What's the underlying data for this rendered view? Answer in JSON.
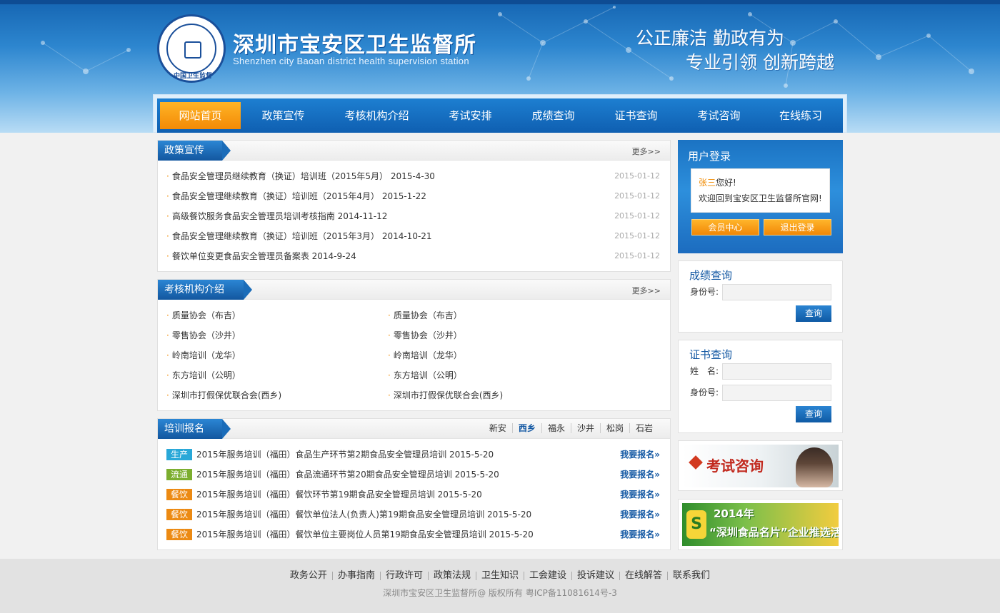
{
  "header": {
    "site_title": "深圳市宝安区卫生监督所",
    "site_subtitle": "Shenzhen city Baoan district  health supervision station",
    "slogan_line1": "公正廉洁  勤政有为",
    "slogan_line2": "专业引领  创新跨越",
    "logo_text": "中国卫生监督"
  },
  "nav": {
    "items": [
      "网站首页",
      "政策宣传",
      "考核机构介绍",
      "考试安排",
      "成绩查询",
      "证书查询",
      "考试咨询",
      "在线练习"
    ],
    "active_index": 0
  },
  "policy": {
    "title": "政策宣传",
    "more": "更多>>",
    "items": [
      {
        "text": "食品安全管理员继续教育（换证）培训班（2015年5月） 2015-4-30",
        "date": "2015-01-12"
      },
      {
        "text": "食品安全管理继续教育（换证）培训班（2015年4月） 2015-1-22",
        "date": "2015-01-12"
      },
      {
        "text": "高级餐饮服务食品安全管理员培训考核指南 2014-11-12",
        "date": "2015-01-12"
      },
      {
        "text": "食品安全管理继续教育（换证）培训班（2015年3月） 2014-10-21",
        "date": "2015-01-12"
      },
      {
        "text": "餐饮单位变更食品安全管理员备案表 2014-9-24",
        "date": "2015-01-12"
      }
    ]
  },
  "orgs": {
    "title": "考核机构介绍",
    "more": "更多>>",
    "left": [
      "质量协会（布吉）",
      "零售协会（沙井）",
      "岭南培训（龙华）",
      "东方培训（公明）",
      "深圳市打假保优联合会(西乡)"
    ],
    "right": [
      "质量协会（布吉）",
      "零售协会（沙井）",
      "岭南培训（龙华）",
      "东方培训（公明）",
      "深圳市打假保优联合会(西乡)"
    ]
  },
  "training": {
    "title": "培训报名",
    "districts": [
      "新安",
      "西乡",
      "福永",
      "沙井",
      "松岗",
      "石岩"
    ],
    "selected_district": "西乡",
    "signup_label": "我要报名»",
    "items": [
      {
        "tag": "生产",
        "tag_color": "#29a8d8",
        "text": "2015年服务培训（福田）食品生产环节第2期食品安全管理员培训 2015-5-20"
      },
      {
        "tag": "流通",
        "tag_color": "#7cae2f",
        "text": "2015年服务培训（福田）食品流通环节第20期食品安全管理员培训 2015-5-20"
      },
      {
        "tag": "餐饮",
        "tag_color": "#ec8a13",
        "text": "2015年服务培训（福田）餐饮环节第19期食品安全管理员培训 2015-5-20"
      },
      {
        "tag": "餐饮",
        "tag_color": "#ec8a13",
        "text": "2015年服务培训（福田）餐饮单位法人(负责人)第19期食品安全管理员培训 2015-5-20"
      },
      {
        "tag": "餐饮",
        "tag_color": "#ec8a13",
        "text": "2015年服务培训（福田）餐饮单位主要岗位人员第19期食品安全管理员培训 2015-5-20"
      }
    ]
  },
  "login": {
    "title": "用户登录",
    "username": "张三",
    "greeting": "您好!",
    "welcome": "欢迎回到宝安区卫生监督所官网!",
    "member_center": "会员中心",
    "logout": "退出登录"
  },
  "score_query": {
    "title": "成绩查询",
    "id_label": "身份号:",
    "id_value": "",
    "button": "查询"
  },
  "cert_query": {
    "title": "证书查询",
    "name_label": "姓　名:",
    "name_value": "",
    "id_label": "身份号:",
    "id_value": "",
    "button": "查询"
  },
  "banners": {
    "consult": "考试咨询",
    "activity_year": "2014年",
    "activity_text": "“深圳食品名片”企业推选活动",
    "activity_logo": "S"
  },
  "footer": {
    "links": [
      "政务公开",
      "办事指南",
      "行政许可",
      "政策法规",
      "卫生知识",
      "工会建设",
      "投诉建议",
      "在线解答",
      "联系我们"
    ],
    "copyright": "深圳市宝安区卫生监督所@ 版权所有   粤ICP备11081614号-3"
  }
}
